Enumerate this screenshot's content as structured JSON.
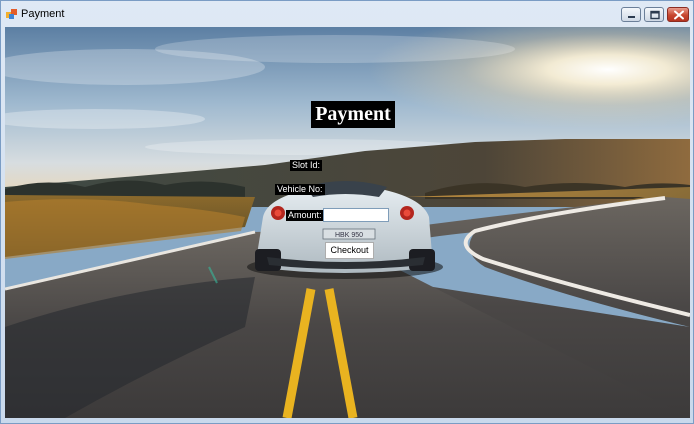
{
  "window": {
    "title": "Payment",
    "controls": {
      "minimize_icon": "minimize-icon",
      "maximize_icon": "maximize-icon",
      "close_icon": "close-icon"
    }
  },
  "form": {
    "heading": "Payment",
    "slot_label": "Slot Id:",
    "vehicle_label": "Vehicle No:",
    "amount_label": "Amount:",
    "amount_value": "",
    "checkout_label": "Checkout"
  },
  "background": {
    "plate_text": "HBK 950"
  }
}
